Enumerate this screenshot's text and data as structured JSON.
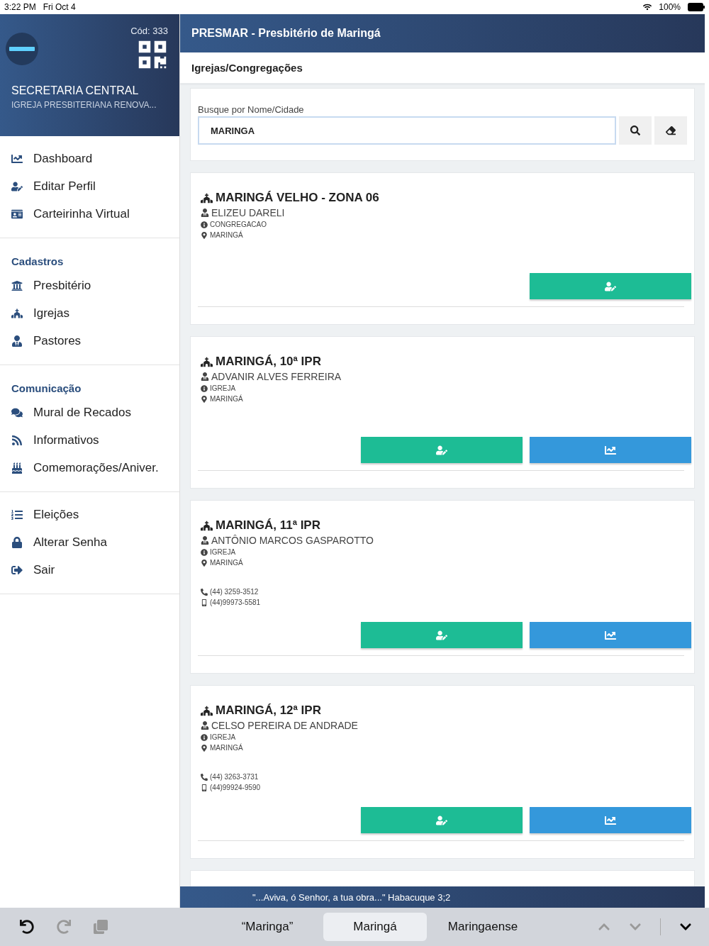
{
  "status_bar": {
    "time": "3:22 PM",
    "date": "Fri Oct 4",
    "battery": "100%"
  },
  "sidebar": {
    "code": "Cód: 333",
    "title": "SECRETARIA CENTRAL",
    "subtitle": "IGREJA PRESBITERIANA RENOVA...",
    "groups": [
      {
        "items": [
          {
            "label": "Dashboard",
            "kind": "chart"
          },
          {
            "label": "Editar Perfil",
            "kind": "user-edit"
          },
          {
            "label": "Carteirinha Virtual",
            "kind": "card"
          }
        ]
      },
      {
        "title": "Cadastros",
        "items": [
          {
            "label": "Presbitério",
            "kind": "building"
          },
          {
            "label": "Igrejas",
            "kind": "church"
          },
          {
            "label": "Pastores",
            "kind": "pastor"
          }
        ]
      },
      {
        "title": "Comunicação",
        "items": [
          {
            "label": "Mural de Recados",
            "kind": "comments"
          },
          {
            "label": "Informativos",
            "kind": "rss"
          },
          {
            "label": "Comemorações/Aniver.",
            "kind": "cake"
          }
        ]
      },
      {
        "items": [
          {
            "label": "Eleições",
            "kind": "list"
          },
          {
            "label": "Alterar Senha",
            "kind": "lock"
          },
          {
            "label": "Sair",
            "kind": "exit"
          }
        ]
      }
    ]
  },
  "header": {
    "brand": "PRESMAR",
    "title": " - Presbitério de Maringá"
  },
  "subheader": "Igrejas/Congregações",
  "search": {
    "label": "Busque por Nome/Cidade",
    "value": "MARINGA"
  },
  "churches": [
    {
      "name": "MARINGÁ VELHO - ZONA 06",
      "pastor": "ELIZEU DARELI",
      "type": "CONGREGACAO",
      "city": "MARINGÁ",
      "buttons": [
        {
          "kind": "profile"
        }
      ]
    },
    {
      "name": "MARINGÁ, 10ª IPR",
      "pastor": "ADVANIR ALVES FERREIRA",
      "type": "IGREJA",
      "city": "MARINGÁ",
      "buttons": [
        {
          "kind": "profile"
        },
        {
          "kind": "chart"
        }
      ]
    },
    {
      "name": "MARINGÁ, 11ª IPR",
      "pastor": "ANTÔNIO MARCOS GASPAROTTO",
      "type": "IGREJA",
      "city": "MARINGÁ",
      "phone": "(44) 3259-3512",
      "mobile": "(44)99973-5581",
      "buttons": [
        {
          "kind": "profile"
        },
        {
          "kind": "chart"
        }
      ]
    },
    {
      "name": "MARINGÁ, 12ª IPR",
      "pastor": "CELSO PEREIRA DE ANDRADE",
      "type": "IGREJA",
      "city": "MARINGÁ",
      "phone": "(44) 3263-3731",
      "mobile": "(44)99924-9590",
      "buttons": [
        {
          "kind": "profile"
        },
        {
          "kind": "chart"
        }
      ]
    }
  ],
  "footer_quote": "\"...Aviva, ó Senhor, a tua obra...\" Habacuque 3;2",
  "keyboard_bar": {
    "suggestions": [
      {
        "label": "“Maringa”",
        "selected": false
      },
      {
        "label": "Maringá",
        "selected": true
      },
      {
        "label": "Maringaense",
        "selected": false
      }
    ]
  }
}
